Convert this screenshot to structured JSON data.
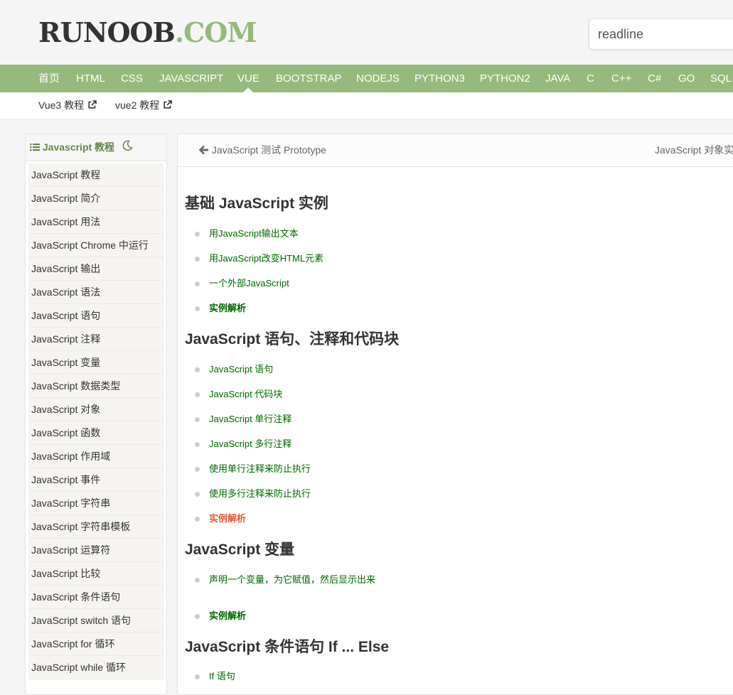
{
  "header": {
    "logo_main": "RUNOOB",
    "logo_suffix": ".COM",
    "search_value": "readline"
  },
  "nav": {
    "items": [
      "首页",
      "HTML",
      "CSS",
      "JAVASCRIPT",
      "VUE",
      "BOOTSTRAP",
      "NODEJS",
      "PYTHON3",
      "PYTHON2",
      "JAVA",
      "C",
      "C++",
      "C#",
      "GO",
      "SQL"
    ],
    "active": "VUE"
  },
  "subnav": {
    "items": [
      "Vue3 教程",
      "vue2 教程"
    ]
  },
  "sidebar": {
    "title": "Javascript 教程",
    "items": [
      "JavaScript 教程",
      "JavaScript 简介",
      "JavaScript 用法",
      "JavaScript Chrome 中运行",
      "JavaScript 输出",
      "JavaScript 语法",
      "JavaScript 语句",
      "JavaScript 注释",
      "JavaScript 变量",
      "JavaScript 数据类型",
      "JavaScript 对象",
      "JavaScript 函数",
      "JavaScript 作用域",
      "JavaScript 事件",
      "JavaScript 字符串",
      "JavaScript 字符串模板",
      "JavaScript 运算符",
      "JavaScript 比较",
      "JavaScript 条件语句",
      "JavaScript switch 语句",
      "JavaScript for 循环",
      "JavaScript while 循环"
    ]
  },
  "main": {
    "prev_label": "JavaScript 测试 Prototype",
    "next_label": "JavaScript 对象实例",
    "sections": [
      {
        "title": "基础 JavaScript 实例",
        "links": [
          "用JavaScript输出文本",
          "用JavaScript改变HTML元素",
          "一个外部JavaScript",
          "实例解析"
        ]
      },
      {
        "title": "JavaScript 语句、注释和代码块",
        "links": [
          "JavaScript 语句",
          "JavaScript 代码块",
          "JavaScript 单行注释",
          "JavaScript 多行注释",
          "使用单行注释来防止执行",
          "使用多行注释来防止执行",
          "实例解析"
        ]
      },
      {
        "title": "JavaScript 变量",
        "links": [
          "声明一个变量，为它赋值，然后显示出来",
          "实例解析"
        ]
      },
      {
        "title": "JavaScript 条件语句 If ... Else",
        "links": [
          "If 语句"
        ]
      }
    ]
  },
  "colors": {
    "brand_green": "#96b97d",
    "link_green": "#006600",
    "highlight_orange": "#e95b2a"
  }
}
